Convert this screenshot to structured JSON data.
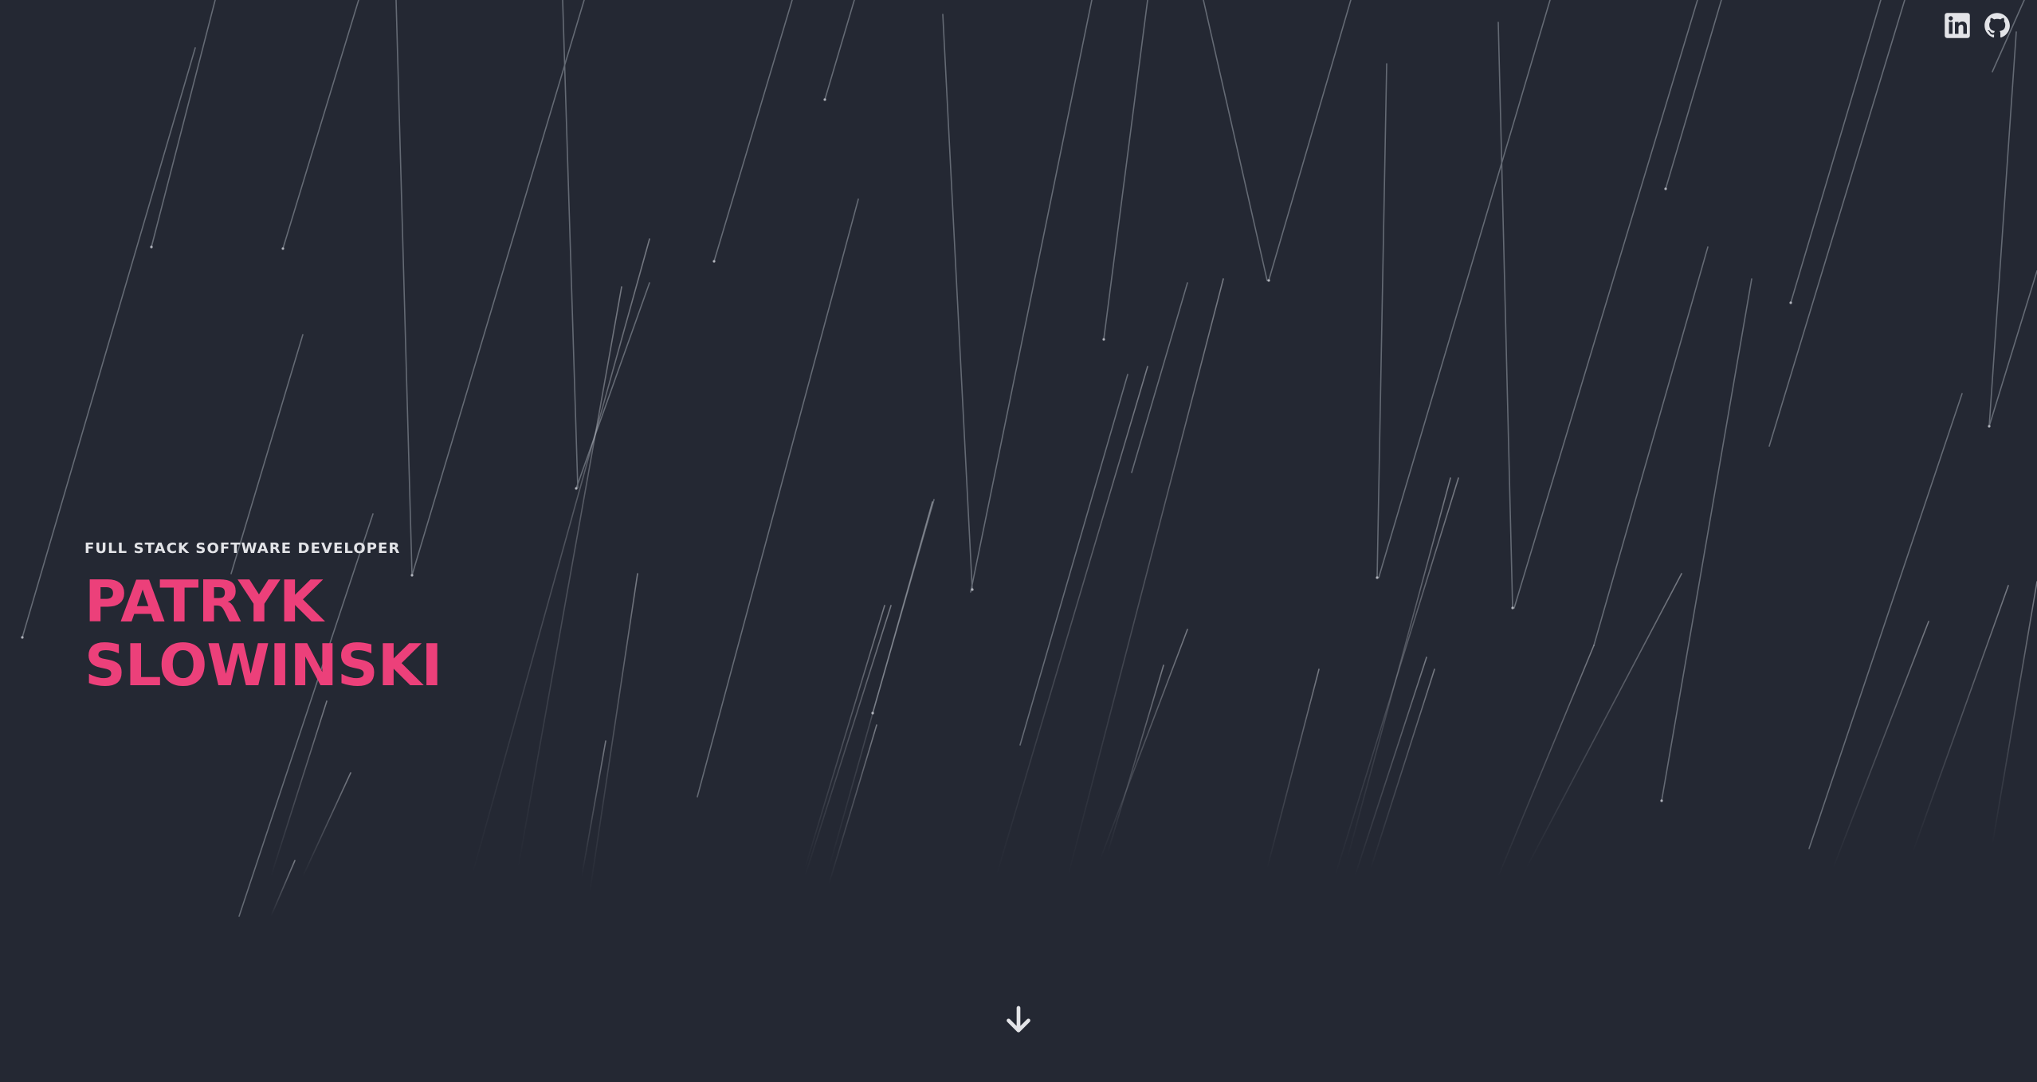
{
  "header": {
    "social": [
      {
        "name": "LinkedIn",
        "icon": "linkedin-icon"
      },
      {
        "name": "GitHub",
        "icon": "github-icon"
      }
    ]
  },
  "hero": {
    "subtitle": "FULL STACK SOFTWARE DEVELOPER",
    "name_line1": "PATRYK",
    "name_line2": "SLOWINSKI"
  },
  "scroll": {
    "icon": "arrow-down-icon"
  },
  "colors": {
    "background": "#242833",
    "accent": "#ec407a",
    "text": "#e3e4e8",
    "rain": "#9aa0aa"
  }
}
